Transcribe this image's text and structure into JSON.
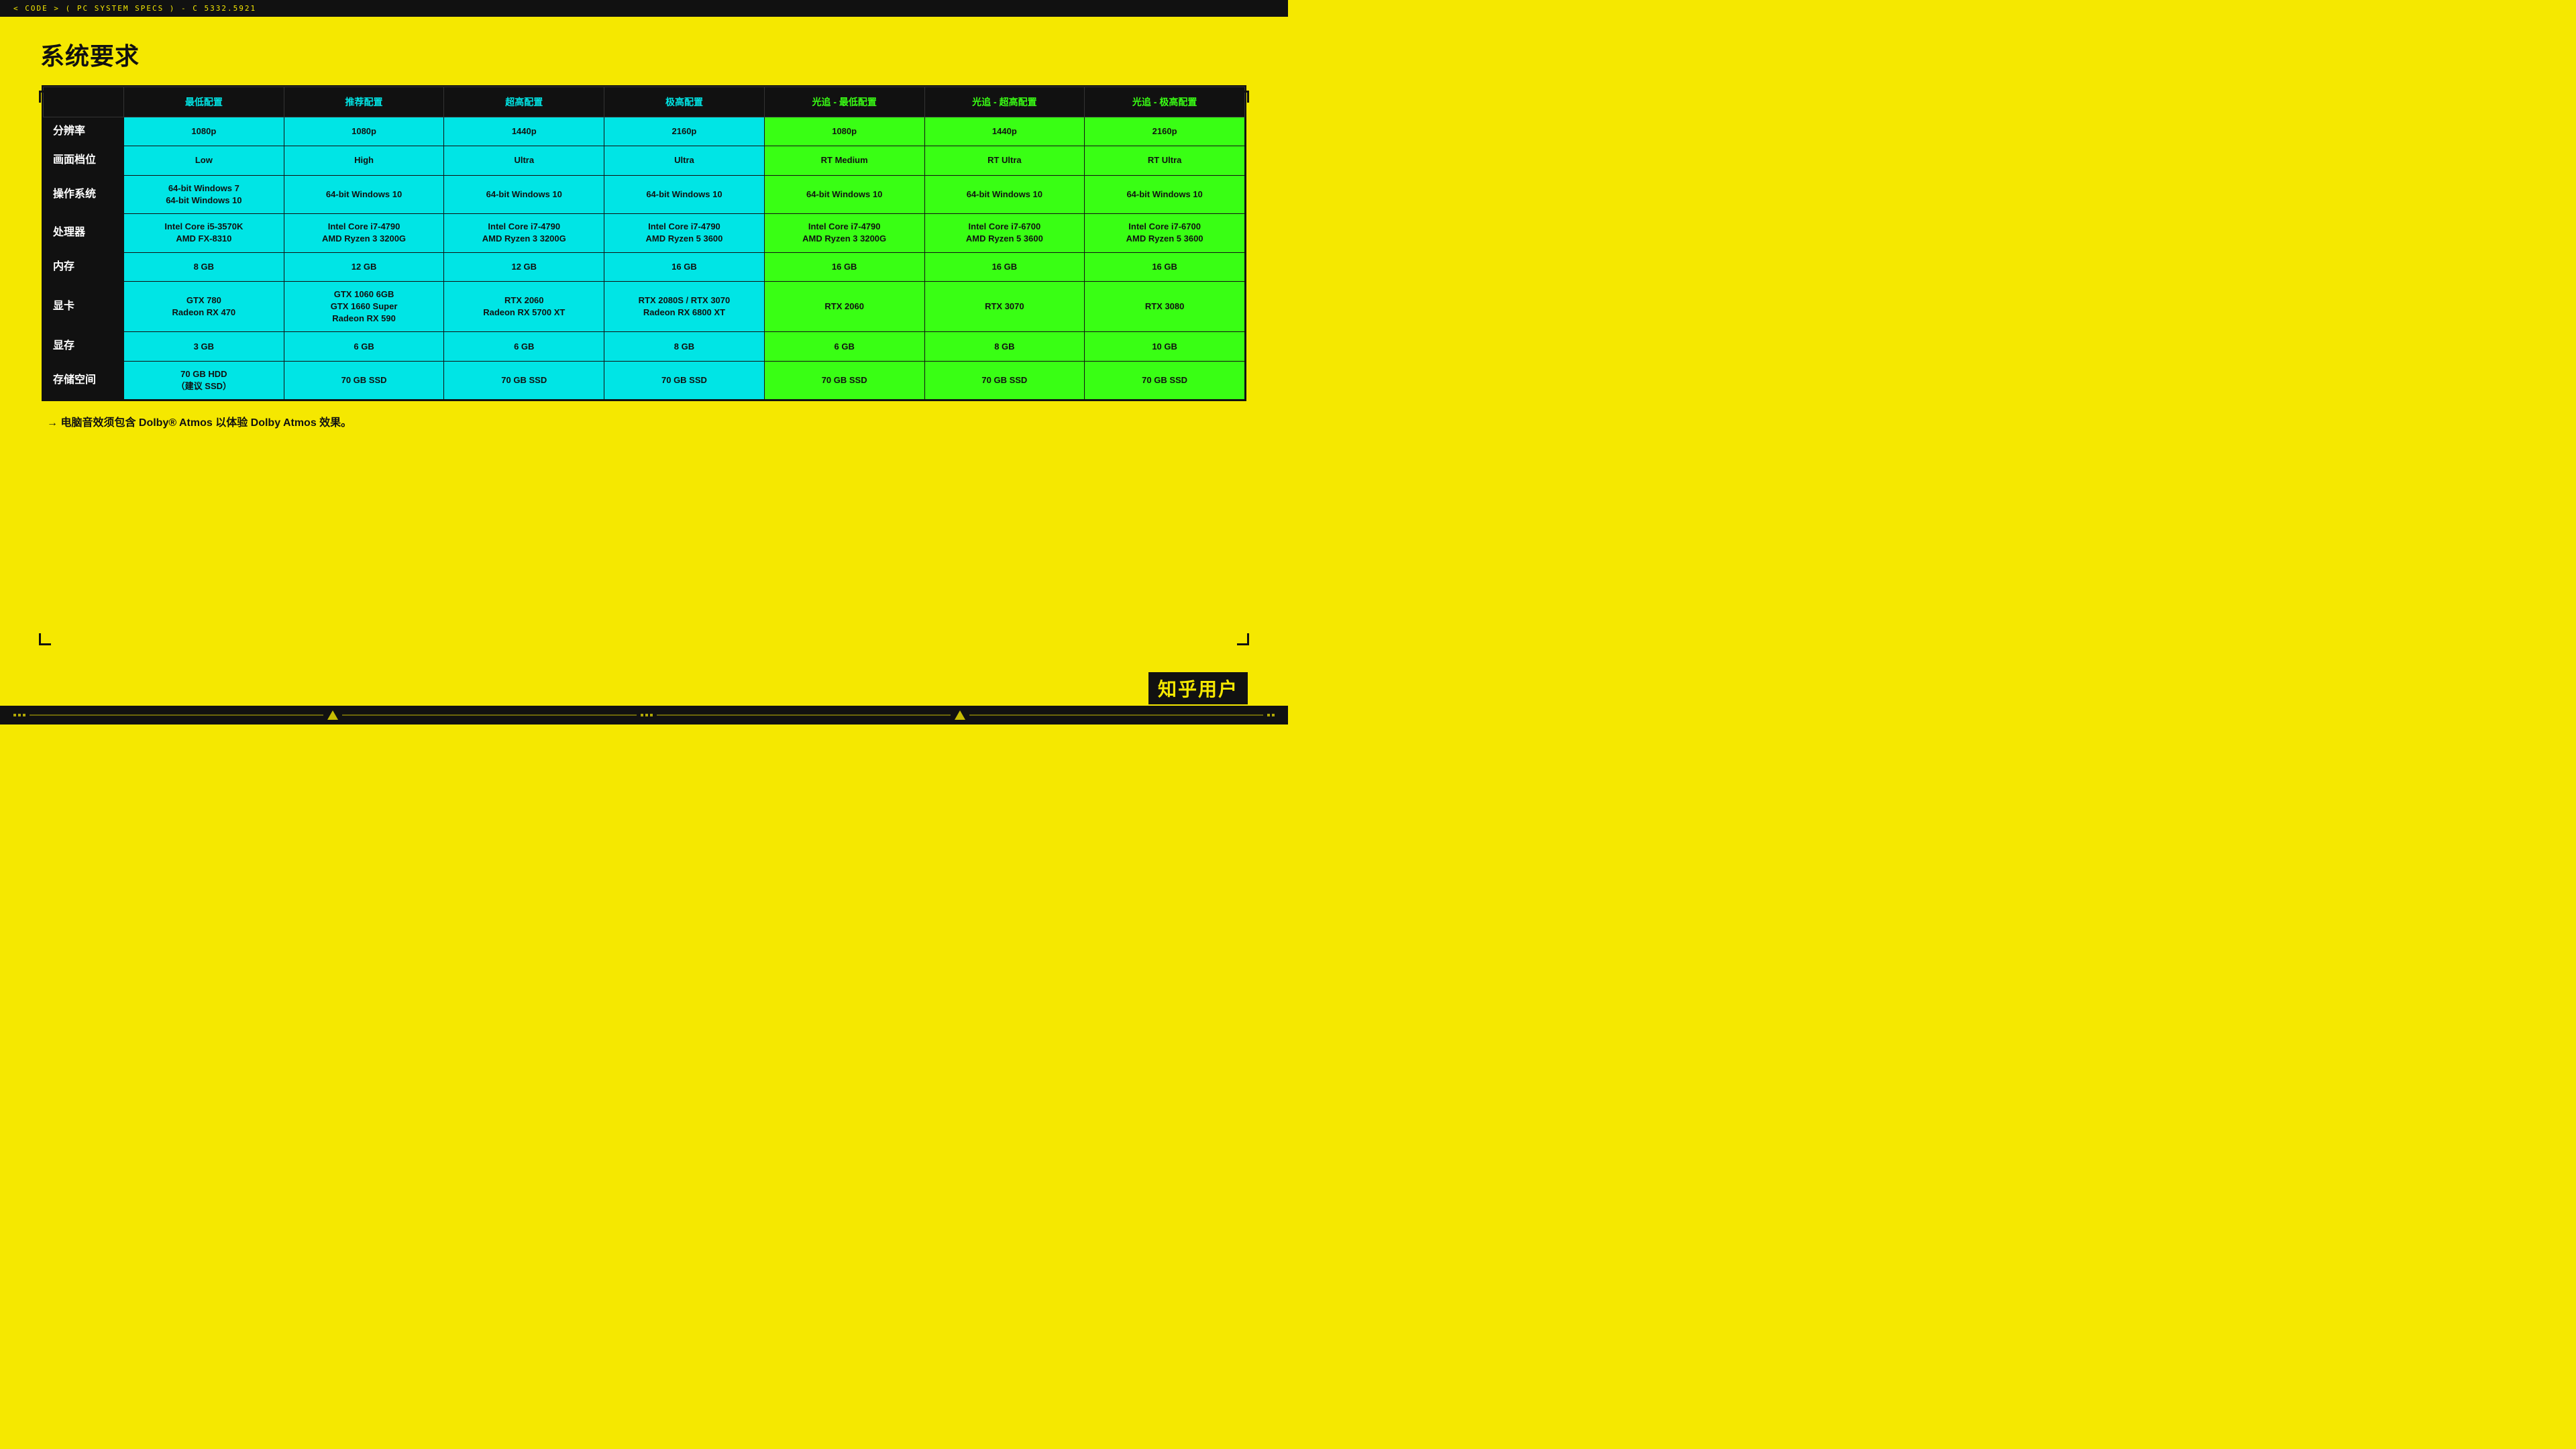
{
  "topbar": {
    "label": "< CODE > ( PC SYSTEM SPECS ) - C 5332.5921"
  },
  "title": "系统要求",
  "table": {
    "headers": [
      {
        "id": "row-label",
        "text": "",
        "type": "row-label"
      },
      {
        "id": "min",
        "text": "最低配置",
        "type": "cyan"
      },
      {
        "id": "rec",
        "text": "推荐配置",
        "type": "cyan"
      },
      {
        "id": "ultra",
        "text": "超高配置",
        "type": "cyan"
      },
      {
        "id": "max",
        "text": "极高配置",
        "type": "cyan"
      },
      {
        "id": "rt-min",
        "text": "光追 - 最低配置",
        "type": "green"
      },
      {
        "id": "rt-ultra",
        "text": "光追 - 超高配置",
        "type": "green"
      },
      {
        "id": "rt-max",
        "text": "光追 - 极高配置",
        "type": "green"
      }
    ],
    "rows": [
      {
        "label": "分辨率",
        "cells": [
          {
            "text": "1080p",
            "type": "cyan"
          },
          {
            "text": "1080p",
            "type": "cyan"
          },
          {
            "text": "1440p",
            "type": "cyan"
          },
          {
            "text": "2160p",
            "type": "cyan"
          },
          {
            "text": "1080p",
            "type": "green"
          },
          {
            "text": "1440p",
            "type": "green"
          },
          {
            "text": "2160p",
            "type": "green"
          }
        ]
      },
      {
        "label": "画面档位",
        "cells": [
          {
            "text": "Low",
            "type": "cyan"
          },
          {
            "text": "High",
            "type": "cyan"
          },
          {
            "text": "Ultra",
            "type": "cyan"
          },
          {
            "text": "Ultra",
            "type": "cyan"
          },
          {
            "text": "RT Medium",
            "type": "green"
          },
          {
            "text": "RT Ultra",
            "type": "green"
          },
          {
            "text": "RT Ultra",
            "type": "green"
          }
        ]
      },
      {
        "label": "操作系统",
        "cells": [
          {
            "text": "64-bit Windows 7\n64-bit Windows 10",
            "type": "cyan"
          },
          {
            "text": "64-bit Windows 10",
            "type": "cyan"
          },
          {
            "text": "64-bit Windows 10",
            "type": "cyan"
          },
          {
            "text": "64-bit Windows 10",
            "type": "cyan"
          },
          {
            "text": "64-bit Windows 10",
            "type": "green"
          },
          {
            "text": "64-bit Windows 10",
            "type": "green"
          },
          {
            "text": "64-bit Windows 10",
            "type": "green"
          }
        ]
      },
      {
        "label": "处理器",
        "cells": [
          {
            "text": "Intel Core i5-3570K\nAMD FX-8310",
            "type": "cyan"
          },
          {
            "text": "Intel Core i7-4790\nAMD Ryzen 3 3200G",
            "type": "cyan"
          },
          {
            "text": "Intel Core i7-4790\nAMD Ryzen 3 3200G",
            "type": "cyan"
          },
          {
            "text": "Intel Core i7-4790\nAMD Ryzen 5 3600",
            "type": "cyan"
          },
          {
            "text": "Intel Core i7-4790\nAMD Ryzen 3 3200G",
            "type": "green"
          },
          {
            "text": "Intel Core i7-6700\nAMD Ryzen 5 3600",
            "type": "green"
          },
          {
            "text": "Intel Core i7-6700\nAMD Ryzen 5 3600",
            "type": "green"
          }
        ]
      },
      {
        "label": "内存",
        "cells": [
          {
            "text": "8 GB",
            "type": "cyan"
          },
          {
            "text": "12 GB",
            "type": "cyan"
          },
          {
            "text": "12 GB",
            "type": "cyan"
          },
          {
            "text": "16 GB",
            "type": "cyan"
          },
          {
            "text": "16 GB",
            "type": "green"
          },
          {
            "text": "16 GB",
            "type": "green"
          },
          {
            "text": "16 GB",
            "type": "green"
          }
        ]
      },
      {
        "label": "显卡",
        "cells": [
          {
            "text": "GTX 780\nRadeon RX 470",
            "type": "cyan"
          },
          {
            "text": "GTX 1060 6GB\nGTX 1660 Super\nRadeon RX 590",
            "type": "cyan"
          },
          {
            "text": "RTX 2060\nRadeon RX 5700 XT",
            "type": "cyan"
          },
          {
            "text": "RTX 2080S / RTX 3070\nRadeon RX 6800 XT",
            "type": "cyan"
          },
          {
            "text": "RTX 2060",
            "type": "green"
          },
          {
            "text": "RTX 3070",
            "type": "green"
          },
          {
            "text": "RTX 3080",
            "type": "green"
          }
        ]
      },
      {
        "label": "显存",
        "cells": [
          {
            "text": "3 GB",
            "type": "cyan"
          },
          {
            "text": "6 GB",
            "type": "cyan"
          },
          {
            "text": "6 GB",
            "type": "cyan"
          },
          {
            "text": "8 GB",
            "type": "cyan"
          },
          {
            "text": "6 GB",
            "type": "green"
          },
          {
            "text": "8 GB",
            "type": "green"
          },
          {
            "text": "10 GB",
            "type": "green"
          }
        ]
      },
      {
        "label": "存储空间",
        "cells": [
          {
            "text": "70 GB HDD\n（建议 SSD）",
            "type": "cyan"
          },
          {
            "text": "70 GB SSD",
            "type": "cyan"
          },
          {
            "text": "70 GB SSD",
            "type": "cyan"
          },
          {
            "text": "70 GB SSD",
            "type": "cyan"
          },
          {
            "text": "70 GB SSD",
            "type": "green"
          },
          {
            "text": "70 GB SSD",
            "type": "green"
          },
          {
            "text": "70 GB SSD",
            "type": "green"
          }
        ]
      }
    ]
  },
  "footer_note": "→ 电脑音效须包含 Dolby® Atmos 以体验 Dolby Atmos 效果。",
  "watermark": "知乎用户"
}
